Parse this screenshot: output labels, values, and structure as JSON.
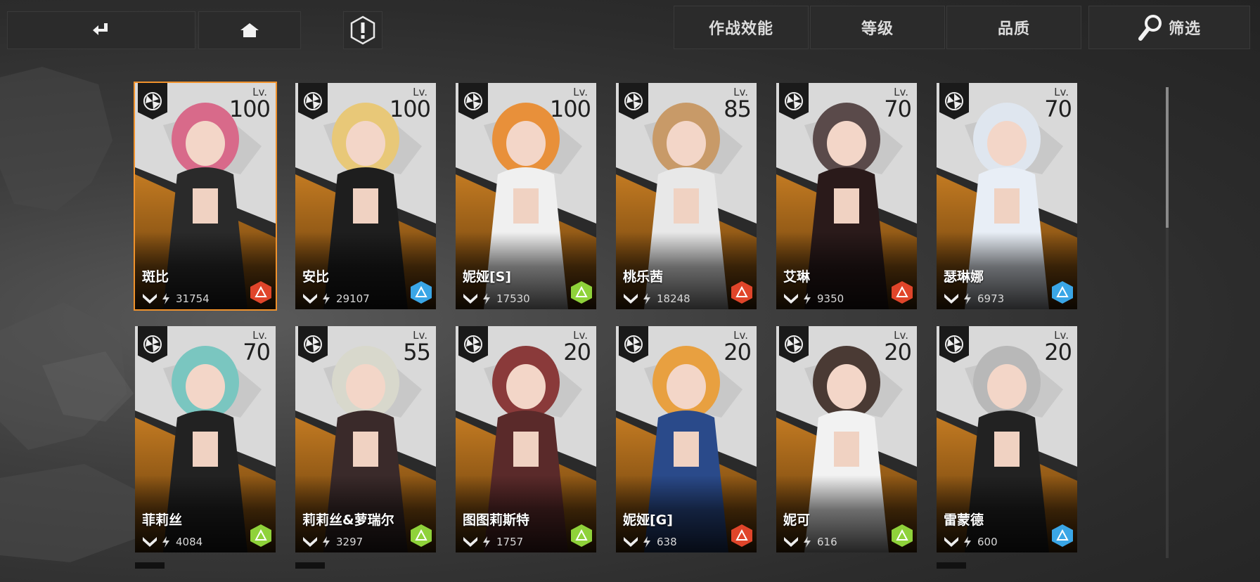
{
  "topbar": {
    "back_icon": "return-arrow-icon",
    "home_icon": "home-icon",
    "alert_icon": "exclamation-hexagon-icon",
    "sort_efficiency": "作战效能",
    "sort_level": "等级",
    "sort_quality": "品质",
    "filter_label": "筛选",
    "filter_icon": "magnifier-icon"
  },
  "colors": {
    "accent_orange": "#f0922c",
    "elem_fire": "#e0452a",
    "elem_ice": "#3aa6e6",
    "elem_nature": "#8fd23a",
    "elem_physical": "#6cc23a"
  },
  "characters": [
    {
      "name": "斑比",
      "lv_label": "Lv.",
      "level": "100",
      "power": "31754",
      "element": "fire",
      "selected": true
    },
    {
      "name": "安比",
      "lv_label": "Lv.",
      "level": "100",
      "power": "29107",
      "element": "ice",
      "selected": false
    },
    {
      "name": "妮娅[S]",
      "lv_label": "Lv.",
      "level": "100",
      "power": "17530",
      "element": "nature",
      "selected": false
    },
    {
      "name": "桃乐茜",
      "lv_label": "Lv.",
      "level": "85",
      "power": "18248",
      "element": "fire",
      "selected": false
    },
    {
      "name": "艾琳",
      "lv_label": "Lv.",
      "level": "70",
      "power": "9350",
      "element": "fire",
      "selected": false
    },
    {
      "name": "瑟琳娜",
      "lv_label": "Lv.",
      "level": "70",
      "power": "6973",
      "element": "ice",
      "selected": false
    },
    {
      "name": "菲莉丝",
      "lv_label": "Lv.",
      "level": "70",
      "power": "4084",
      "element": "nature",
      "selected": false
    },
    {
      "name": "莉莉丝&萝瑞尔",
      "lv_label": "Lv.",
      "level": "55",
      "power": "3297",
      "element": "nature",
      "selected": false
    },
    {
      "name": "图图莉斯特",
      "lv_label": "Lv.",
      "level": "20",
      "power": "1757",
      "element": "nature",
      "selected": false
    },
    {
      "name": "妮娅[G]",
      "lv_label": "Lv.",
      "level": "20",
      "power": "638",
      "element": "fire",
      "selected": false
    },
    {
      "name": "妮可",
      "lv_label": "Lv.",
      "level": "20",
      "power": "616",
      "element": "nature",
      "selected": false
    },
    {
      "name": "雷蒙德",
      "lv_label": "Lv.",
      "level": "20",
      "power": "600",
      "element": "ice",
      "selected": false
    }
  ]
}
